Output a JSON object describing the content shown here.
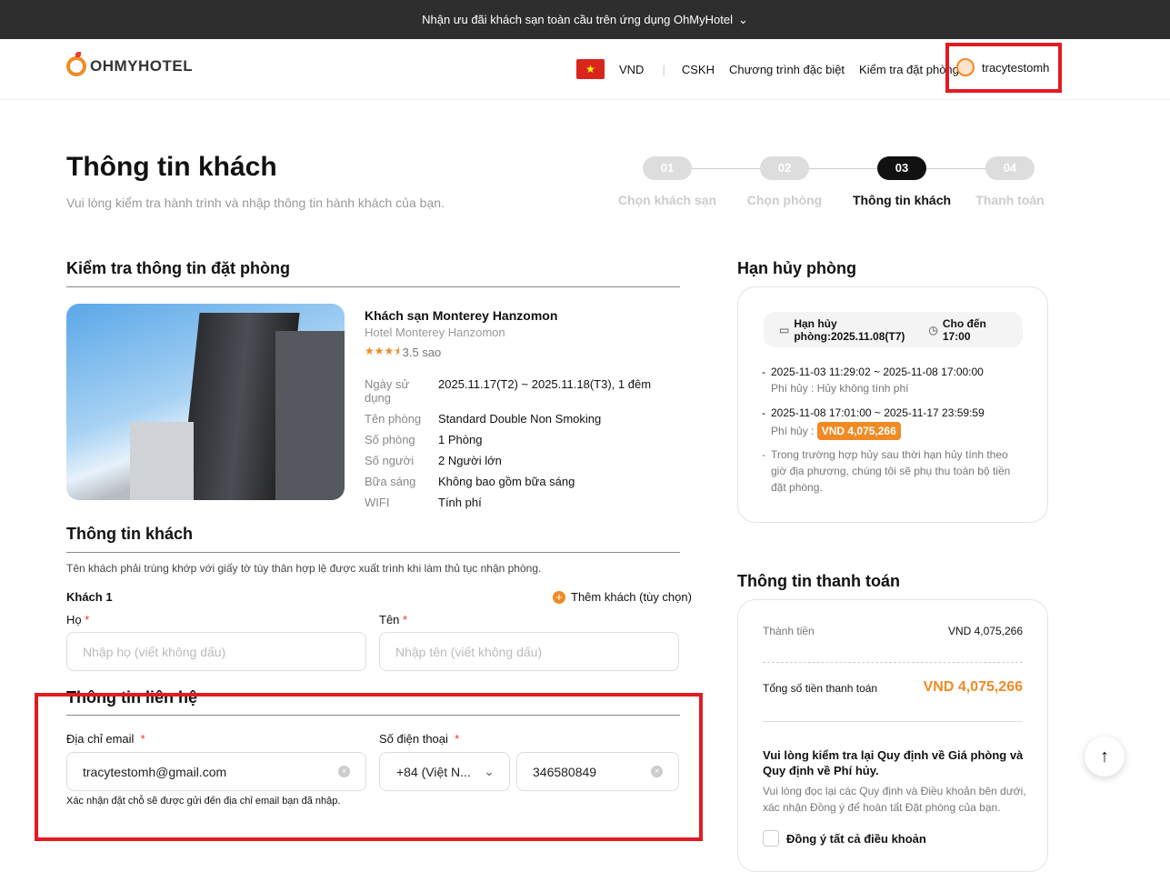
{
  "promo_bar": {
    "text": "Nhận ưu đãi khách sạn toàn cầu trên ứng dụng OhMyHotel"
  },
  "header": {
    "logo": "OHMYHOTEL",
    "currency": "VND",
    "nav": [
      "CSKH",
      "Chương trình đặc biệt",
      "Kiểm tra đặt phòng"
    ],
    "username": "tracytestomh"
  },
  "page": {
    "title": "Thông tin khách",
    "subtitle": "Vui lòng kiểm tra hành trình và nhập thông tin hành khách của bạn."
  },
  "steps": [
    {
      "num": "01",
      "label": "Chọn khách sạn"
    },
    {
      "num": "02",
      "label": "Chọn phòng"
    },
    {
      "num": "03",
      "label": "Thông tin khách",
      "active": true
    },
    {
      "num": "04",
      "label": "Thanh toán"
    }
  ],
  "booking": {
    "section_title": "Kiểm tra thông tin đặt phòng",
    "hotel_name": "Khách sạn Monterey Hanzomon",
    "hotel_name_en": "Hotel Monterey Hanzomon",
    "rating": 3.5,
    "rating_label": "3.5 sao",
    "details": [
      {
        "k": "Ngày sử dụng",
        "v": "2025.11.17(T2) ~ 2025.11.18(T3), 1 đêm"
      },
      {
        "k": "Tên phòng",
        "v": "Standard Double Non Smoking"
      },
      {
        "k": "Số phòng",
        "v": "1 Phòng"
      },
      {
        "k": "Số người",
        "v": "2 Người lớn"
      },
      {
        "k": "Bữa sáng",
        "v": "Không bao gồm bữa sáng"
      },
      {
        "k": "WIFI",
        "v": "Tính phí"
      }
    ]
  },
  "guest": {
    "section_title": "Thông tin khách",
    "note": "Tên khách phải trùng khớp với giấy tờ tùy thân hợp lệ được xuất trình khi làm thủ tục nhận phòng.",
    "guest_label": "Khách 1",
    "add_guest": "Thêm khách (tùy chọn)",
    "last_name_label": "Họ",
    "last_name_placeholder": "Nhập họ (viết không dấu)",
    "first_name_label": "Tên",
    "first_name_placeholder": "Nhập tên (viết không dấu)"
  },
  "contact": {
    "section_title": "Thông tin liên hệ",
    "email_label": "Địa chỉ email",
    "email_value": "tracytestomh@gmail.com",
    "phone_label": "Số điện thoại",
    "country_code": "+84 (Việt N...",
    "phone_value": "346580849",
    "email_note": "Xác nhận đặt chỗ sẽ được gửi đến địa chỉ email bạn đã nhập."
  },
  "cancellation": {
    "section_title": "Hạn hủy phòng",
    "deadline": "Hạn hủy phòng:2025.11.08(T7)",
    "until": "Cho đến 17:00",
    "rules": [
      {
        "period": "2025-11-03 11:29:02 ~ 2025-11-08 17:00:00",
        "fee_label": "Phí hủy :",
        "fee": "Hủy không tính phí"
      },
      {
        "period": "2025-11-08 17:01:00 ~ 2025-11-17 23:59:59",
        "fee_label": "Phí hủy :",
        "fee": "VND 4,075,266"
      }
    ],
    "note": "Trong trường hợp hủy sau thời hạn hủy tính theo giờ địa phương, chúng tôi sẽ phụ thu toàn bộ tiền đặt phòng."
  },
  "payment": {
    "section_title": "Thông tin thanh toán",
    "subtotal_label": "Thành tiền",
    "subtotal": "VND 4,075,266",
    "total_label": "Tổng số tiền thanh toán",
    "total": "VND 4,075,266",
    "policy_title": "Vui lòng kiểm tra lại Quy định về Giá phòng và Quy định về Phí hủy.",
    "policy_text": "Vui lòng đọc lại các Quy định và Điều khoản bên dưới, xác nhận Đồng ý để hoàn tất Đặt phòng của bạn.",
    "agree_all": "Đồng ý tất cả điều khoản"
  },
  "colors": {
    "accent": "#f08a24",
    "annotation": "#e21b22"
  }
}
